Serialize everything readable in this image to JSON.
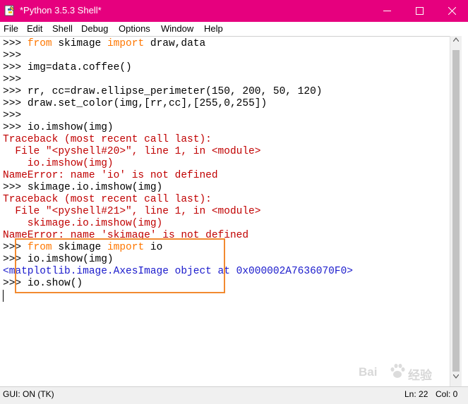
{
  "window": {
    "title": "*Python 3.5.3 Shell*",
    "titlebar_color": "#e6007e"
  },
  "menu": {
    "items": [
      "File",
      "Edit",
      "Shell",
      "Debug",
      "Options",
      "Window",
      "Help"
    ]
  },
  "shell": {
    "lines": [
      {
        "prompt": ">>> ",
        "parts": [
          {
            "t": "from",
            "c": "kw"
          },
          {
            "t": " skimage ",
            "c": ""
          },
          {
            "t": "import",
            "c": "kw"
          },
          {
            "t": " draw,data",
            "c": ""
          }
        ]
      },
      {
        "prompt": ">>> ",
        "parts": []
      },
      {
        "prompt": ">>> ",
        "parts": [
          {
            "t": "img=data.coffee()",
            "c": ""
          }
        ]
      },
      {
        "prompt": ">>> ",
        "parts": []
      },
      {
        "prompt": ">>> ",
        "parts": [
          {
            "t": "rr, cc=draw.ellipse_perimeter(150, 200, 50, 120)",
            "c": ""
          }
        ]
      },
      {
        "prompt": ">>> ",
        "parts": [
          {
            "t": "draw.set_color(img,[rr,cc],[255,0,255])",
            "c": ""
          }
        ]
      },
      {
        "prompt": ">>> ",
        "parts": []
      },
      {
        "prompt": ">>> ",
        "parts": [
          {
            "t": "io.imshow(img)",
            "c": ""
          }
        ]
      },
      {
        "prompt": "",
        "parts": [
          {
            "t": "Traceback (most recent call last):",
            "c": "err"
          }
        ]
      },
      {
        "prompt": "",
        "parts": [
          {
            "t": "  File \"<pyshell#20>\", line 1, in <module>",
            "c": "err"
          }
        ]
      },
      {
        "prompt": "",
        "parts": [
          {
            "t": "    io.imshow(img)",
            "c": "err"
          }
        ]
      },
      {
        "prompt": "",
        "parts": [
          {
            "t": "NameError: name 'io' is not defined",
            "c": "err"
          }
        ]
      },
      {
        "prompt": ">>> ",
        "parts": [
          {
            "t": "skimage.io.imshow(img)",
            "c": ""
          }
        ]
      },
      {
        "prompt": "",
        "parts": [
          {
            "t": "Traceback (most recent call last):",
            "c": "err"
          }
        ]
      },
      {
        "prompt": "",
        "parts": [
          {
            "t": "  File \"<pyshell#21>\", line 1, in <module>",
            "c": "err"
          }
        ]
      },
      {
        "prompt": "",
        "parts": [
          {
            "t": "    skimage.io.imshow(img)",
            "c": "err"
          }
        ]
      },
      {
        "prompt": "",
        "parts": [
          {
            "t": "NameError: name 'skimage' is not defined",
            "c": "err"
          }
        ]
      },
      {
        "prompt": ">>> ",
        "parts": [
          {
            "t": "from",
            "c": "kw"
          },
          {
            "t": " skimage ",
            "c": ""
          },
          {
            "t": "import",
            "c": "kw"
          },
          {
            "t": " io",
            "c": ""
          }
        ]
      },
      {
        "prompt": ">>> ",
        "parts": [
          {
            "t": "io.imshow(img)",
            "c": ""
          }
        ]
      },
      {
        "prompt": "",
        "parts": [
          {
            "t": "<matplotlib.image.AxesImage object at 0x000002A7636070F0>",
            "c": "out"
          }
        ]
      },
      {
        "prompt": ">>> ",
        "parts": [
          {
            "t": "io.show()",
            "c": ""
          }
        ]
      }
    ]
  },
  "status": {
    "gui": "GUI: ON (TK)",
    "ln": "Ln: 22",
    "col": "Col: 0"
  },
  "watermark": {
    "text1": "Bai",
    "text2": "经验"
  },
  "colors": {
    "keyword": "#ff7700",
    "error": "#c00000",
    "output": "#1a1acc",
    "highlight_box": "#f28a30"
  }
}
